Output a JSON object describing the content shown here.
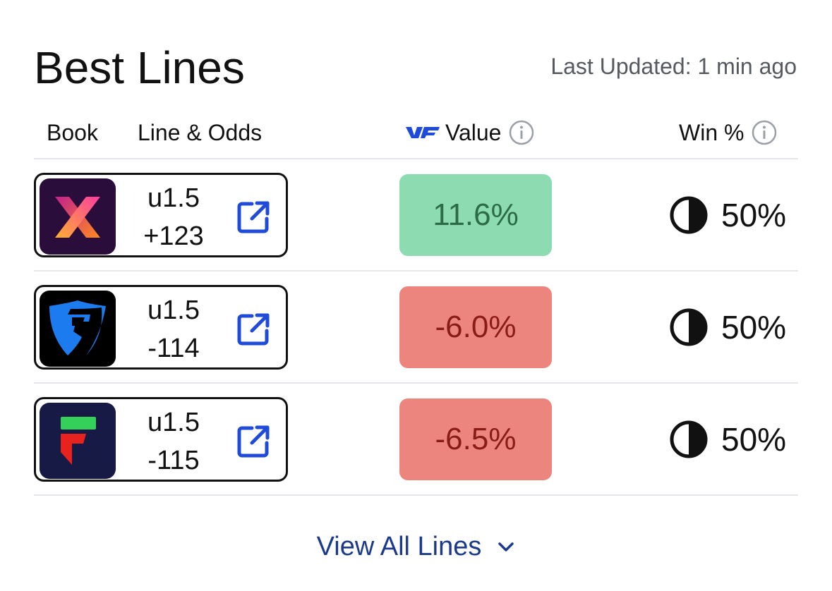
{
  "header": {
    "title": "Best Lines",
    "last_updated": "Last Updated: 1 min ago"
  },
  "columns": {
    "book": "Book",
    "line_odds": "Line & Odds",
    "value": "Value",
    "win": "Win %"
  },
  "rows": [
    {
      "book_icon": "x-logo-icon",
      "line": "u1.5",
      "odds": "+123",
      "value": "11.6%",
      "value_bg": "#8ddcb1",
      "value_color": "#2d6a46",
      "win": "50%"
    },
    {
      "book_icon": "shield-logo-icon",
      "line": "u1.5",
      "odds": "-114",
      "value": "-6.0%",
      "value_bg": "#ec857d",
      "value_color": "#8a1c18",
      "win": "50%"
    },
    {
      "book_icon": "f-logo-icon",
      "line": "u1.5",
      "odds": "-115",
      "value": "-6.5%",
      "value_bg": "#ec857d",
      "value_color": "#8a1c18",
      "win": "50%"
    }
  ],
  "footer": {
    "view_all": "View All Lines"
  },
  "colors": {
    "accent": "#1c3a8c",
    "link_icon": "#1f4bd8",
    "positive_bg": "#8ddcb1",
    "negative_bg": "#ec857d"
  }
}
